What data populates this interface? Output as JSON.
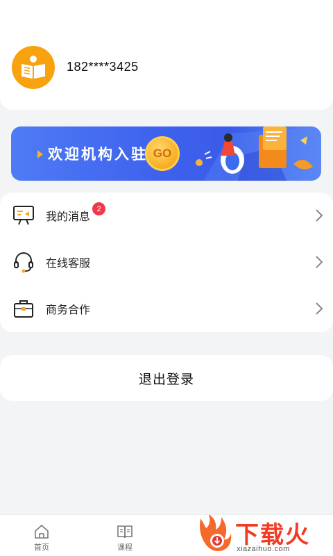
{
  "profile": {
    "phone": "182****3425",
    "avatar_icon": "book-reader-icon"
  },
  "banner": {
    "text": "欢迎机构入驻",
    "go_label": "GO"
  },
  "menu": {
    "items": [
      {
        "label": "我的消息",
        "icon": "message-screen-icon",
        "badge": "2"
      },
      {
        "label": "在线客服",
        "icon": "headset-icon"
      },
      {
        "label": "商务合作",
        "icon": "briefcase-icon"
      }
    ]
  },
  "logout": {
    "label": "退出登录"
  },
  "tabbar": {
    "tabs": [
      {
        "label": "首页",
        "icon": "home-icon"
      },
      {
        "label": "课程",
        "icon": "book-icon"
      }
    ]
  },
  "watermark": {
    "text": "下载火",
    "subtext": "xiazaihuo.com"
  },
  "colors": {
    "accent_orange": "#f7a20e",
    "banner_blue": "#3f63ee",
    "badge_red": "#f0384a",
    "background": "#f3f4f6"
  }
}
